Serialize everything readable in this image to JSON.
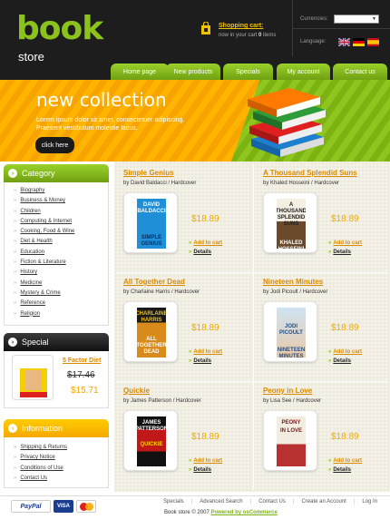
{
  "logo": {
    "main": "book",
    "sub": "store"
  },
  "cart": {
    "title": "Shopping cart:",
    "status_prefix": "now in your cart",
    "count": "0",
    "status_suffix": "items"
  },
  "header": {
    "currencies_label": "Currencies:",
    "currency_value": "",
    "language_label": "Language:"
  },
  "languages": [
    "english",
    "german",
    "spanish"
  ],
  "nav": [
    "Home page",
    "New products",
    "Specials",
    "My account",
    "Contact us"
  ],
  "banner": {
    "title": "new collection",
    "text": "Lorem ipsum dolor sit amet, consectetuer adipiscing. Praesent vestibulum molestie lacus.",
    "button": "click here"
  },
  "category": {
    "title": "Category",
    "items": [
      "Biography",
      "Business & Money",
      "Children",
      "Computing & Internet",
      "Cooking, Food & Wine",
      "Diet & Health",
      "Education",
      "Fiction & Literature",
      "History",
      "Medicine",
      "Mystery & Crime",
      "Reference",
      "Religion"
    ]
  },
  "special": {
    "title": "Special",
    "product": "5 Factor Diet",
    "old_price": "$17.46",
    "new_price": "$15.71"
  },
  "information": {
    "title": "Information",
    "items": [
      "Shipping & Returns",
      "Privacy Notice",
      "Conditions of Use",
      "Contact Us"
    ]
  },
  "products": [
    {
      "title": "Simple Genius",
      "author": "by David Baldacci / Hardcover",
      "price": "$18.89",
      "cover_author": "DAVID BALDACCI",
      "cover_title": "SIMPLE GENIUS"
    },
    {
      "title": "A Thousand Splendid Suns",
      "author": "by Khaled Hosseini / Hardcover",
      "price": "$18.89",
      "cover_author": "A THOUSAND SPLENDID SUNS",
      "cover_title": "KHALED HOSSEINI"
    },
    {
      "title": "All Together Dead",
      "author": "by Charlaine Harris / Hardcover",
      "price": "$18.89",
      "cover_author": "CHARLAINE HARRIS",
      "cover_title": "ALL TOGETHER DEAD"
    },
    {
      "title": "Nineteen Minutes",
      "author": "by Jodi Picoult / Hardcover",
      "price": "$18.89",
      "cover_author": "JODI PICOULT",
      "cover_title": "NINETEEN MINUTES"
    },
    {
      "title": "Quickie",
      "author": "by James Patterson / Hardcover",
      "price": "$18.89",
      "cover_author": "JAMES PATTERSON",
      "cover_title": "QUICKIE"
    },
    {
      "title": "Peony in Love",
      "author": "by Lisa See / Hardcover",
      "price": "$18.89",
      "cover_author": "PEONY",
      "cover_title": "IN LOVE"
    }
  ],
  "product_actions": {
    "add_to_cart": "Add to cart",
    "details": "Details"
  },
  "footer": {
    "links": [
      "Specials",
      "Advanced Search",
      "Contact Us",
      "Create an Account",
      "Log In"
    ],
    "copyright_prefix": "Book store © 2007",
    "copyright_link": "Powered by osCommerce",
    "payments": [
      "PayPal",
      "VISA",
      "MasterCard"
    ]
  },
  "colors": {
    "green": "#8cc21c",
    "orange": "#f0a800",
    "dark": "#1d1d1d"
  }
}
